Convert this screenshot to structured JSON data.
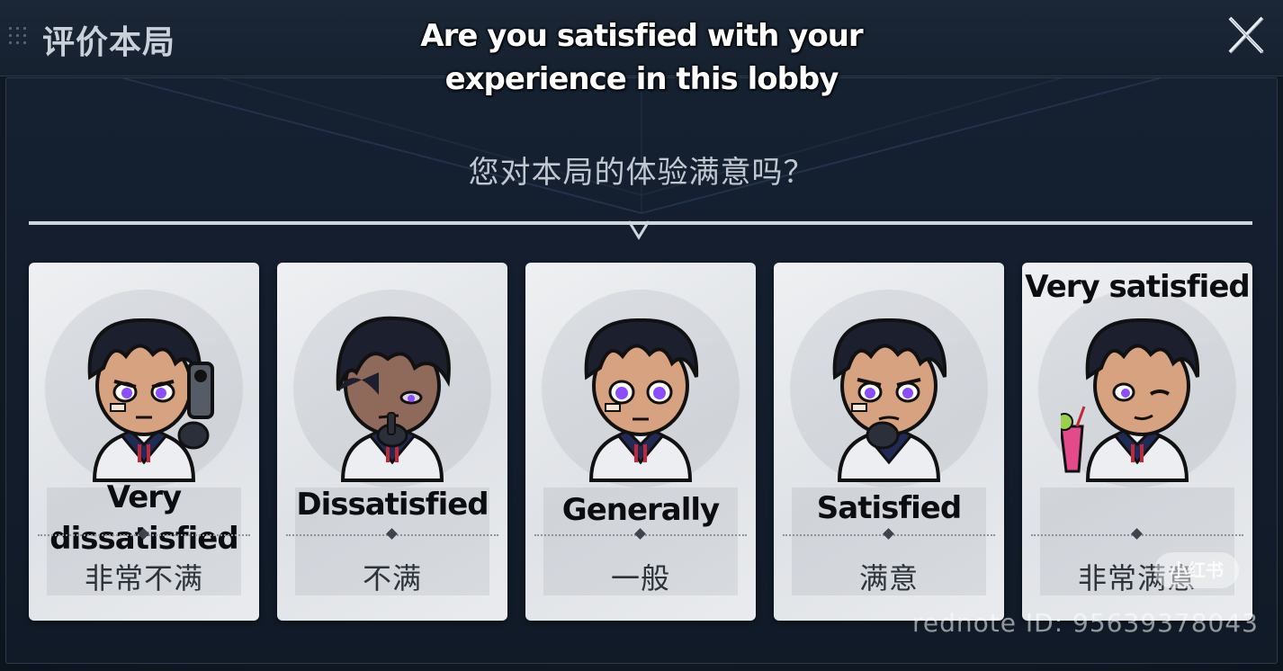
{
  "header": {
    "title": "评价本局",
    "close_icon": "close-x-icon"
  },
  "caption": {
    "english_question": "Are you satisfied with your experience in this lobby"
  },
  "question": "您对本局的体验满意吗？",
  "ratings": [
    {
      "caption": "Very dissatisfied",
      "label": "非常不满",
      "avatar": "avatar-pointing-gun-icon"
    },
    {
      "caption": "Dissatisfied",
      "label": "不满",
      "avatar": "avatar-hand-on-chin-icon"
    },
    {
      "caption": "Generally",
      "label": "一般",
      "avatar": "avatar-neutral-icon"
    },
    {
      "caption": "Satisfied",
      "label": "满意",
      "avatar": "avatar-fist-pump-icon"
    },
    {
      "caption": "Very satisfied",
      "label": "非常满意",
      "avatar": "avatar-wink-drink-icon"
    }
  ],
  "watermark": {
    "id_text": "rednote ID: 95639378043",
    "badge_text": "小红书"
  },
  "colors": {
    "background": "#121b27",
    "card": "#e6e8eb",
    "hair": "#1c1f2e",
    "eyes": "#8a4dff",
    "jacket_accent": "#c0283a"
  }
}
